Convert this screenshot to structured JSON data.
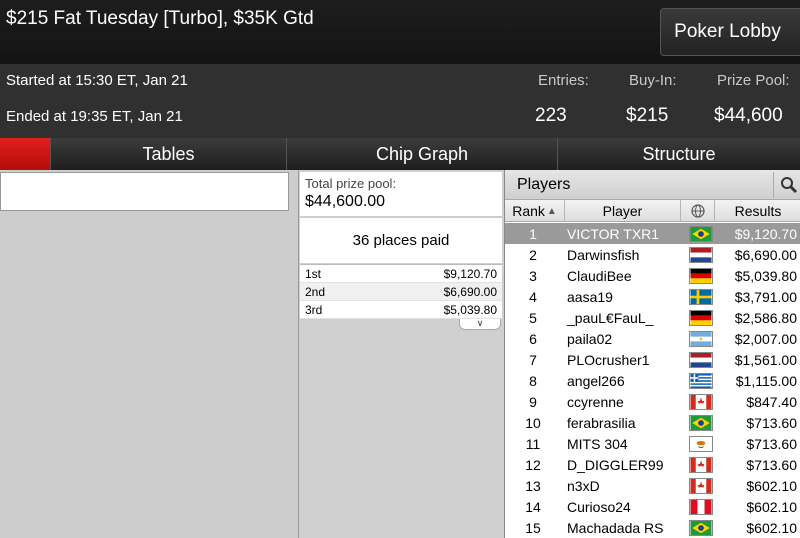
{
  "header": {
    "title": "$215 Fat Tuesday [Turbo], $35K Gtd",
    "lobby_button": "Poker Lobby"
  },
  "info": {
    "started": "Started at 15:30 ET, Jan 21",
    "ended": "Ended at 19:35 ET, Jan 21",
    "entries_label": "Entries:",
    "entries_value": "223",
    "buyin_label": "Buy-In:",
    "buyin_value": "$215",
    "prizepool_label": "Prize Pool:",
    "prizepool_value": "$44,600"
  },
  "tabs": [
    {
      "label": ""
    },
    {
      "label": "Tables"
    },
    {
      "label": "Chip Graph"
    },
    {
      "label": "Structure"
    }
  ],
  "prize": {
    "total_label": "Total prize pool:",
    "total_value": "$44,600.00",
    "places_paid": "36 places paid",
    "places": [
      {
        "place": "1st",
        "amount": "$9,120.70"
      },
      {
        "place": "2nd",
        "amount": "$6,690.00"
      },
      {
        "place": "3rd",
        "amount": "$5,039.80"
      }
    ],
    "expand_icon": "double-chevron-down-icon"
  },
  "players": {
    "title": "Players",
    "search_icon": "magnifier-icon",
    "columns": {
      "rank": "Rank",
      "player": "Player",
      "country_icon": "globe-icon",
      "results": "Results"
    },
    "rows": [
      {
        "rank": "1",
        "name": "VICTOR TXR1",
        "flag": "brazil",
        "result": "$9,120.70"
      },
      {
        "rank": "2",
        "name": "Darwinsfish",
        "flag": "netherlands",
        "result": "$6,690.00"
      },
      {
        "rank": "3",
        "name": "ClaudiBee",
        "flag": "germany",
        "result": "$5,039.80"
      },
      {
        "rank": "4",
        "name": "aasa19",
        "flag": "sweden",
        "result": "$3,791.00"
      },
      {
        "rank": "5",
        "name": "_pauL€FauL_",
        "flag": "germany",
        "result": "$2,586.80"
      },
      {
        "rank": "6",
        "name": "paila02",
        "flag": "argentina",
        "result": "$2,007.00"
      },
      {
        "rank": "7",
        "name": "PLOcrusher1",
        "flag": "netherlands",
        "result": "$1,561.00"
      },
      {
        "rank": "8",
        "name": "angel266",
        "flag": "greece",
        "result": "$1,115.00"
      },
      {
        "rank": "9",
        "name": "ccyrenne",
        "flag": "canada",
        "result": "$847.40"
      },
      {
        "rank": "10",
        "name": "ferabrasilia",
        "flag": "brazil",
        "result": "$713.60"
      },
      {
        "rank": "11",
        "name": "MITS 304",
        "flag": "cyprus",
        "result": "$713.60"
      },
      {
        "rank": "12",
        "name": "D_DIGGLER99",
        "flag": "canada",
        "result": "$713.60"
      },
      {
        "rank": "13",
        "name": "n3xD",
        "flag": "canada",
        "result": "$602.10"
      },
      {
        "rank": "14",
        "name": "Curioso24",
        "flag": "peru",
        "result": "$602.10"
      },
      {
        "rank": "15",
        "name": "Machadada RS",
        "flag": "brazil",
        "result": "$602.10"
      }
    ]
  },
  "colors": {
    "accent_red": "#d4160f",
    "selected_row": "#9a9a9a"
  }
}
